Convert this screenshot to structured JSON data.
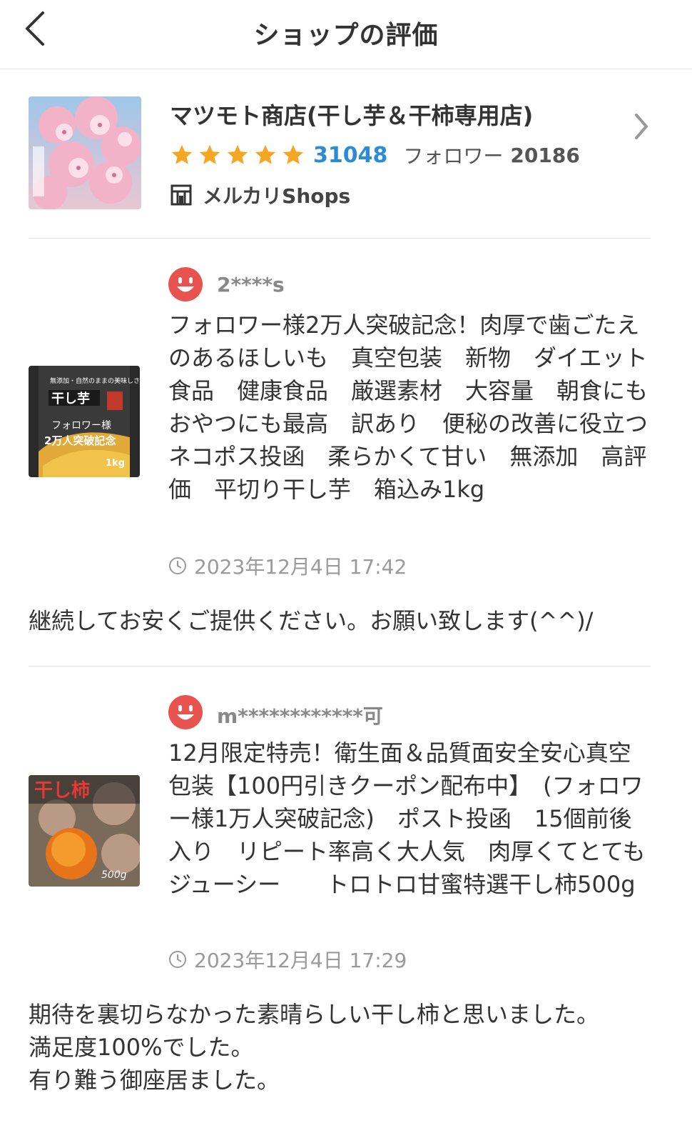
{
  "header": {
    "title": "ショップの評価"
  },
  "shop": {
    "name": "マツモト商店(干し芋＆干柿専用店)",
    "rating_stars": 5,
    "rating_count": "31048",
    "follower_label": "フォロワー",
    "follower_count": "20186",
    "badge_label": "メルカリShops",
    "image_caption": "河津桜"
  },
  "reviews": [
    {
      "user": "2****s",
      "product_title": "フォロワー様2万人突破記念！肉厚で歯ごたえのあるほしいも　真空包装　新物　ダイエット食品　健康食品　厳選素材　大容量　朝食にもおやつにも最高　訳あり　便秘の改善に役立つ　ネコポス投函　柔らかくて甘い　無添加　高評価　平切り干し芋　箱込み1kg",
      "date": "2023年12月4日 17:42",
      "comment": "継続してお安くご提供ください。お願い致します(^^)/",
      "image_text": {
        "top": "無添加・自然のままの美味しさ",
        "main": "干し芋",
        "sub": "フォロワー様",
        "sub2": "2万人突破記念",
        "weight": "1kg"
      }
    },
    {
      "user": "m************可",
      "product_title": "12月限定特売！衛生面＆品質面安全安心真空包装【100円引きクーポン配布中】　(フォロワー様1万人突破記念)　ポスト投函　15個前後入り　リピート率高く大人気　肉厚くてとてもジューシー　　トロトロ甘蜜特選干し柿500g",
      "date": "2023年12月4日 17:29",
      "comment": "期待を裏切らなかった素晴らしい干し柿と思いました。\n満足度100%でした。\n有り難う御座居ました。",
      "image_text": {
        "main": "干し柿",
        "weight": "500g"
      }
    }
  ],
  "colors": {
    "star": "#f5a623",
    "accent_blue": "#2a8bd6",
    "avatar": "#e8534f"
  }
}
